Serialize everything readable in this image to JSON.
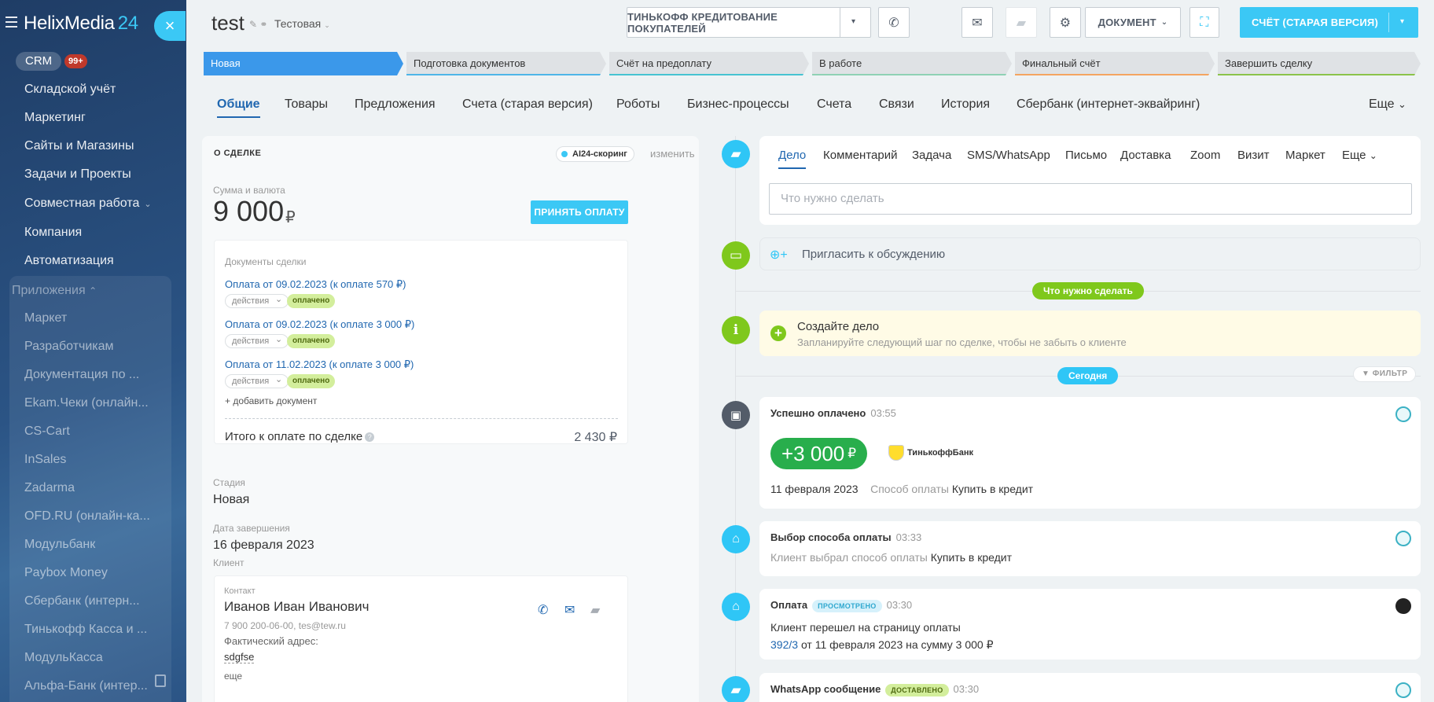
{
  "sidebar": {
    "logo_main": "HelixMedia",
    "logo_num": "24",
    "close_glyph": "×",
    "crm_label": "CRM",
    "crm_badge": "99+",
    "items": [
      {
        "label": "Складской учёт"
      },
      {
        "label": "Маркетинг"
      },
      {
        "label": "Сайты и Магазины"
      },
      {
        "label": "Задачи и Проекты"
      },
      {
        "label": "Совместная работа",
        "chevron": "⌄"
      },
      {
        "label": "Компания"
      },
      {
        "label": "Автоматизация"
      }
    ],
    "apps_title": "Приложения",
    "apps_chevron": "⌃",
    "apps": [
      "Маркет",
      "Разработчикам",
      "Документация по ...",
      "Ekam.Чеки (онлайн...",
      "CS-Cart",
      "InSales",
      "Zadarma",
      "OFD.RU (онлайн-ка...",
      "Модульбанк",
      "Paybox Money",
      "Сбербанк (интерн...",
      "Тинькофф Касса и ...",
      "МодульКасса",
      "Альфа-Банк (интер..."
    ]
  },
  "header": {
    "title": "test",
    "edit_glyph": "✎ ⚭",
    "category": "Тестовая",
    "category_caret": "⌄",
    "tinkoff_button": "ТИНЬКОФФ КРЕДИТОВАНИЕ ПОКУПАТЕЛЕЙ",
    "caret": "▾",
    "phone_glyph": "✆",
    "mail_glyph": "✉",
    "chat_glyph": "▰",
    "gear_glyph": "⚙",
    "document_button": "ДОКУМЕНТ",
    "document_caret": "⌄",
    "scan_glyph": "⛶",
    "invoice_button": "СЧЁТ (СТАРАЯ ВЕРСИЯ)"
  },
  "stages": [
    "Новая",
    "Подготовка документов",
    "Счёт на предоплату",
    "В работе",
    "Финальный счёт",
    "Завершить сделку"
  ],
  "stage_colors": [
    "#3b98ea",
    "#4eb5e8",
    "#47c3d1",
    "#8fd1b4",
    "#f4a460",
    "#8bc34a"
  ],
  "tabs": [
    "Общие",
    "Товары",
    "Предложения",
    "Счета (старая версия)",
    "Роботы",
    "Бизнес-процессы",
    "Счета",
    "Связи",
    "История",
    "Сбербанк (интернет-эквайринг)"
  ],
  "tabs_more": "Еще",
  "tabs_more_caret": "⌄",
  "deal": {
    "header": "О СДЕЛКЕ",
    "ai_label": "AI24-скоринг",
    "change": "изменить",
    "sum_label": "Сумма и валюта",
    "amount": "9 000",
    "currency": "₽",
    "accept_button": "ПРИНЯТЬ ОПЛАТУ",
    "docs_title": "Документы сделки",
    "docs": [
      {
        "link": "Оплата от 09.02.2023 (к оплате 570 ₽)",
        "actions": "действия",
        "status": "оплачено"
      },
      {
        "link": "Оплата от 09.02.2023 (к оплате 3 000 ₽)",
        "actions": "действия",
        "status": "оплачено"
      },
      {
        "link": "Оплата от 11.02.2023 (к оплате 3 000 ₽)",
        "actions": "действия",
        "status": "оплачено"
      }
    ],
    "add_doc": "+ добавить документ",
    "total_label": "Итого к оплате по сделке",
    "total_q": "?",
    "total_value": "2 430 ₽",
    "stage_label": "Стадия",
    "stage_value": "Новая",
    "close_label": "Дата завершения",
    "close_value": "16 февраля 2023",
    "client_label": "Клиент",
    "contact_label": "Контакт",
    "contact_name": "Иванов Иван Иванович",
    "contact_info": "7 900 200-06-00, tes@tew.ru",
    "address_label": "Фактический адрес:",
    "address_value": "sdgfse",
    "more": "еще",
    "phone_glyph": "✆",
    "mail_glyph": "✉",
    "chat_glyph": "▰"
  },
  "timeline": {
    "composer_tabs": [
      "Дело",
      "Комментарий",
      "Задача",
      "SMS/WhatsApp",
      "Письмо",
      "Доставка",
      "Zoom",
      "Визит",
      "Маркет",
      "Еще"
    ],
    "composer_more_caret": "⌄",
    "composer_placeholder": "Что нужно сделать",
    "invite_glyph": "⊕+",
    "invite_text": "Пригласить к обсуждению",
    "todo_pill": "Что нужно сделать",
    "todo_plus": "+",
    "todo_title": "Создайте дело",
    "todo_sub": "Запланируйте следующий шаг по сделке, чтобы не забыть о клиенте",
    "today_pill": "Сегодня",
    "filter": "ФИЛЬТР",
    "icons": {
      "chat": "▰",
      "comment": "▭",
      "info": "i",
      "wallet": "▣",
      "basket": "⌂"
    },
    "paid": {
      "title": "Успешно оплачено",
      "time": "03:55",
      "amount": "+3 000",
      "currency": "₽",
      "bank_name": "ТинькоффБанк",
      "date": "11 февраля 2023",
      "method_label": "Способ оплаты",
      "method_value": "Купить в кредит"
    },
    "choose": {
      "title": "Выбор способа оплаты",
      "time": "03:33",
      "label": "Клиент выбрал способ оплаты",
      "value": "Купить в кредит"
    },
    "payment": {
      "title": "Оплата",
      "badge": "ПРОСМОТРЕНО",
      "time": "03:30",
      "line1": "Клиент перешел на страницу оплаты",
      "link": "392/3",
      "line2": "от 11 февраля 2023 на сумму 3 000 ₽"
    },
    "whatsapp": {
      "title": "WhatsApp сообщение",
      "badge": "ДОСТАВЛЕНО",
      "time": "03:30"
    }
  },
  "colors": {
    "accent": "#3bc8f5",
    "link": "#2067b0",
    "green": "#7fc81c",
    "paid_green": "#28ae4c"
  }
}
